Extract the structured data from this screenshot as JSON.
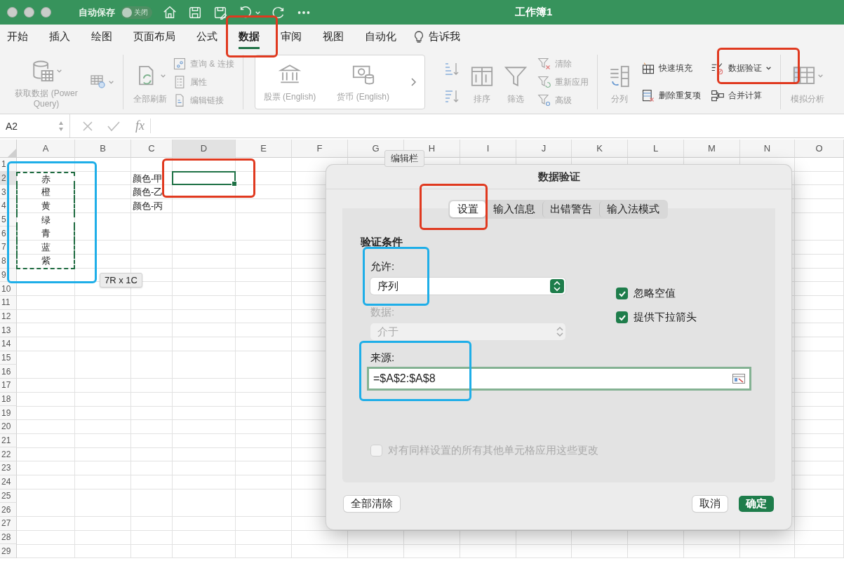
{
  "title_bar": {
    "autosave_label": "自动保存",
    "autosave_toggle": {
      "label": "关闭",
      "on": false
    },
    "title": "工作簿1"
  },
  "menu_tabs": [
    {
      "label": "开始",
      "selected": false
    },
    {
      "label": "插入",
      "selected": false
    },
    {
      "label": "绘图",
      "selected": false
    },
    {
      "label": "页面布局",
      "selected": false
    },
    {
      "label": "公式",
      "selected": false
    },
    {
      "label": "数据",
      "selected": true
    },
    {
      "label": "审阅",
      "selected": false
    },
    {
      "label": "视图",
      "selected": false
    },
    {
      "label": "自动化",
      "selected": false
    }
  ],
  "tell_me": "告诉我",
  "ribbon": {
    "groups": [
      {
        "kind": "plain",
        "columns": [
          [
            {
              "kind": "large",
              "label": "获取数据 (Power Query)",
              "caret": true,
              "disabled": true
            }
          ],
          [
            {
              "kind": "icon",
              "caret": true,
              "disabled": true
            }
          ]
        ]
      },
      {
        "kind": "plain",
        "columns": [
          [
            {
              "kind": "large",
              "label": "全部刷新",
              "caret": true,
              "disabled": true
            }
          ],
          [
            {
              "kind": "small",
              "label": "查询 & 连接",
              "caret": false,
              "disabled": true
            },
            {
              "kind": "small",
              "label": "属性",
              "caret": false,
              "disabled": true
            },
            {
              "kind": "small",
              "label": "编辑链接",
              "caret": false,
              "disabled": true
            }
          ]
        ]
      },
      {
        "kind": "gallery",
        "columns": [
          [
            {
              "kind": "large",
              "label": "股票 (English)",
              "caret": false,
              "disabled": true
            }
          ],
          [
            {
              "kind": "large",
              "label": "货币 (English)",
              "caret": false,
              "disabled": true
            }
          ]
        ]
      },
      {
        "kind": "plain",
        "columns": [
          [
            {
              "kind": "icon",
              "caret": false,
              "disabled": true
            },
            {
              "kind": "icon",
              "caret": false,
              "disabled": true
            }
          ],
          [
            {
              "kind": "large",
              "label": "排序",
              "caret": false,
              "disabled": true
            }
          ],
          [
            {
              "kind": "large",
              "label": "筛选",
              "caret": false,
              "disabled": true
            }
          ],
          [
            {
              "kind": "small",
              "label": "清除",
              "caret": false,
              "disabled": true
            },
            {
              "kind": "small",
              "label": "重新应用",
              "caret": false,
              "disabled": true
            },
            {
              "kind": "small",
              "label": "高级",
              "caret": false,
              "disabled": true
            }
          ]
        ]
      },
      {
        "kind": "plain",
        "columns": [
          [
            {
              "kind": "large",
              "label": "分列",
              "caret": false,
              "disabled": true
            }
          ],
          [
            {
              "kind": "small",
              "label": "快速填充",
              "caret": false,
              "disabled": false
            },
            {
              "kind": "small",
              "label": "删除重复项",
              "caret": false,
              "disabled": false
            }
          ],
          [
            {
              "kind": "small",
              "label": "数据验证",
              "caret": true,
              "disabled": false
            },
            {
              "kind": "small",
              "label": "合并计算",
              "caret": false,
              "disabled": false
            }
          ]
        ]
      },
      {
        "kind": "plain",
        "columns": [
          [
            {
              "kind": "large",
              "label": "模拟分析",
              "caret": true,
              "disabled": true
            }
          ]
        ]
      }
    ]
  },
  "formula_bar": {
    "name_box": "A2",
    "function_label": "fx",
    "tooltip": "编辑栏"
  },
  "sheet": {
    "columns": [
      "A",
      "B",
      "C",
      "D",
      "E",
      "F",
      "G",
      "H",
      "I",
      "J",
      "K",
      "L",
      "M",
      "N",
      "O"
    ],
    "rows": [
      {
        "header": "1",
        "cells": []
      },
      {
        "header": "2",
        "cells": [
          {
            "text": "赤",
            "copied": true,
            "selected": false
          },
          null,
          {
            "text": "颜色-甲",
            "copied": false,
            "selected": false
          },
          {
            "copied": false,
            "selected": true
          }
        ]
      },
      {
        "header": "3",
        "cells": [
          {
            "text": "橙",
            "copied": true,
            "selected": false
          },
          null,
          {
            "text": "颜色-乙",
            "copied": false,
            "selected": false
          }
        ]
      },
      {
        "header": "4",
        "cells": [
          {
            "text": "黄",
            "copied": true,
            "selected": false
          },
          null,
          {
            "text": "颜色-丙",
            "copied": false,
            "selected": false
          }
        ]
      },
      {
        "header": "5",
        "cells": [
          {
            "text": "绿",
            "copied": true,
            "selected": false
          }
        ]
      },
      {
        "header": "6",
        "cells": [
          {
            "text": "青",
            "copied": true,
            "selected": false
          }
        ]
      },
      {
        "header": "7",
        "cells": [
          {
            "text": "蓝",
            "copied": true,
            "selected": false
          }
        ]
      },
      {
        "header": "8",
        "cells": [
          {
            "text": "紫",
            "copied": true,
            "selected": false
          }
        ]
      },
      {
        "header": "9",
        "cells": []
      },
      {
        "header": "10",
        "cells": []
      },
      {
        "header": "11",
        "cells": []
      },
      {
        "header": "12",
        "cells": []
      },
      {
        "header": "13",
        "cells": []
      },
      {
        "header": "14",
        "cells": []
      },
      {
        "header": "15",
        "cells": []
      },
      {
        "header": "16",
        "cells": []
      },
      {
        "header": "17",
        "cells": []
      },
      {
        "header": "18",
        "cells": []
      },
      {
        "header": "19",
        "cells": []
      },
      {
        "header": "20",
        "cells": []
      },
      {
        "header": "21",
        "cells": []
      },
      {
        "header": "22",
        "cells": []
      },
      {
        "header": "23",
        "cells": []
      },
      {
        "header": "24",
        "cells": []
      },
      {
        "header": "25",
        "cells": []
      },
      {
        "header": "26",
        "cells": []
      },
      {
        "header": "27",
        "cells": []
      },
      {
        "header": "28",
        "cells": []
      },
      {
        "header": "29",
        "cells": []
      }
    ],
    "size_tip": "7R x 1C"
  },
  "dialog": {
    "title": "数据验证",
    "tabs": [
      {
        "label": "设置",
        "selected": true
      },
      {
        "label": "输入信息",
        "selected": false
      },
      {
        "label": "出错警告",
        "selected": false
      },
      {
        "label": "输入法模式",
        "selected": false
      }
    ],
    "section_title": "验证条件",
    "allow_field": {
      "label": "允许:",
      "value": "序列",
      "disabled": false
    },
    "data_field": {
      "label": "数据:",
      "value": "介于",
      "disabled": true
    },
    "checkboxes": [
      {
        "label": "忽略空值",
        "checked": true
      },
      {
        "label": "提供下拉箭头",
        "checked": true
      }
    ],
    "source_field": {
      "label": "来源:",
      "value": "=$A$2:$A$8",
      "focused": true
    },
    "apply_all": {
      "label": "对有同样设置的所有其他单元格应用这些更改",
      "checked": false,
      "disabled": true
    },
    "left_buttons": [
      "全部清除"
    ],
    "right_buttons": [
      {
        "label": "取消",
        "default": false
      },
      {
        "label": "确定",
        "default": true
      }
    ]
  },
  "annotations": [
    {
      "color": "#e0391f"
    },
    {
      "color": "#e0391f"
    },
    {
      "color": "#1eaee8"
    },
    {
      "color": "#e0391f"
    },
    {
      "color": "#e0391f"
    },
    {
      "color": "#1eaee8"
    },
    {
      "color": "#1eaee8"
    }
  ]
}
